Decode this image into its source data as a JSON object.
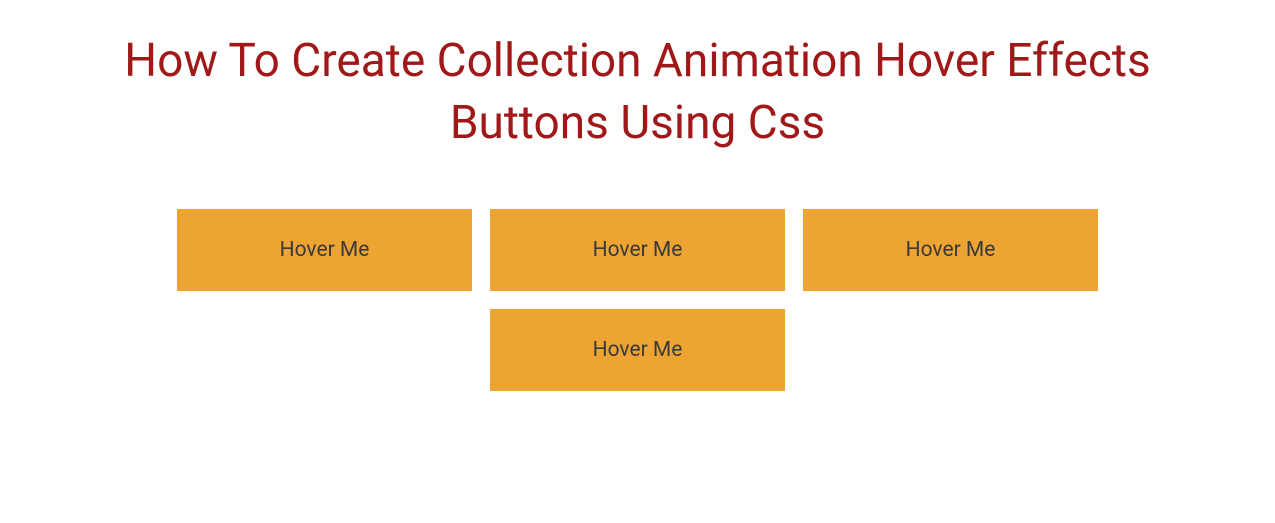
{
  "title": "How To Create Collection Animation Hover Effects Buttons Using Css",
  "buttons": [
    {
      "label": "Hover Me"
    },
    {
      "label": "Hover Me"
    },
    {
      "label": "Hover Me"
    },
    {
      "label": "Hover Me"
    }
  ]
}
